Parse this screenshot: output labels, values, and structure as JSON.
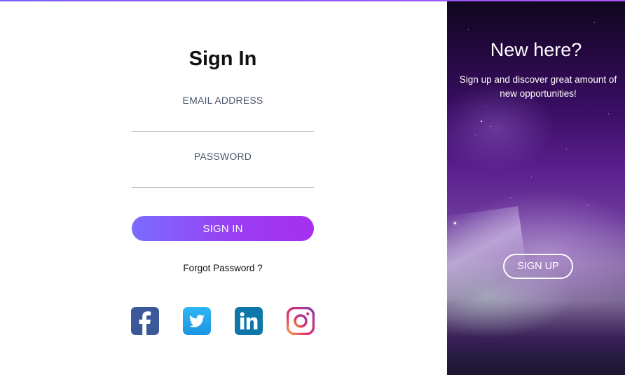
{
  "signin": {
    "title": "Sign In",
    "email_label": "EMAIL ADDRESS",
    "email_value": "",
    "password_label": "PASSWORD",
    "password_value": "",
    "signin_button": "SIGN IN",
    "forgot_password": "Forgot Password ?"
  },
  "social": [
    {
      "name": "facebook",
      "icon": "facebook-icon",
      "color": "#3b5998"
    },
    {
      "name": "twitter",
      "icon": "twitter-icon",
      "color": "#1da1f2"
    },
    {
      "name": "linkedin",
      "icon": "linkedin-icon",
      "color": "#0e76a8"
    },
    {
      "name": "instagram",
      "icon": "instagram-icon",
      "color": "#c13584"
    }
  ],
  "promo": {
    "title": "New here?",
    "text": "Sign up and discover great amount of new opportunities!",
    "signup_button": "SIGN UP"
  },
  "colors": {
    "accent_start": "#7b6cff",
    "accent_end": "#a72ff0",
    "promo_bg": "#3c0f66"
  }
}
